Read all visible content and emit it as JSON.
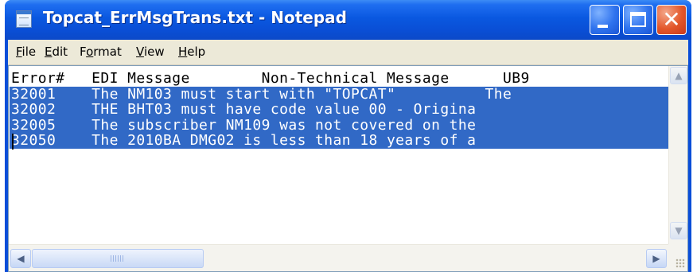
{
  "window": {
    "title": "Topcat_ErrMsgTrans.txt - Notepad",
    "icon": "notepad-icon",
    "controls": {
      "minimize": "minimize-icon",
      "maximize": "maximize-icon",
      "close": "✕"
    }
  },
  "menubar": {
    "items": [
      {
        "acc": "F",
        "rest": "ile"
      },
      {
        "acc": "E",
        "rest": "dit"
      },
      {
        "pre": "F",
        "acc": "o",
        "rest": "rmat"
      },
      {
        "acc": "V",
        "rest": "iew"
      },
      {
        "acc": "H",
        "rest": "elp"
      }
    ]
  },
  "document": {
    "lines": [
      "Error#   EDI Message        Non-Technical Message      UB9",
      "32001    The NM103 must start with \"TOPCAT\"          The",
      "32002    THE BHT03 must have code value 00 - Origina",
      "32005    The subscriber NM109 was not covered on the",
      "32050    The 2010BA DMG02 is less than 18 years of a"
    ],
    "selected_line_count": 4,
    "selection_color": "#3169c6"
  },
  "scrollbars": {
    "up": "▲",
    "down": "▼",
    "left": "◀",
    "right": "▶"
  }
}
